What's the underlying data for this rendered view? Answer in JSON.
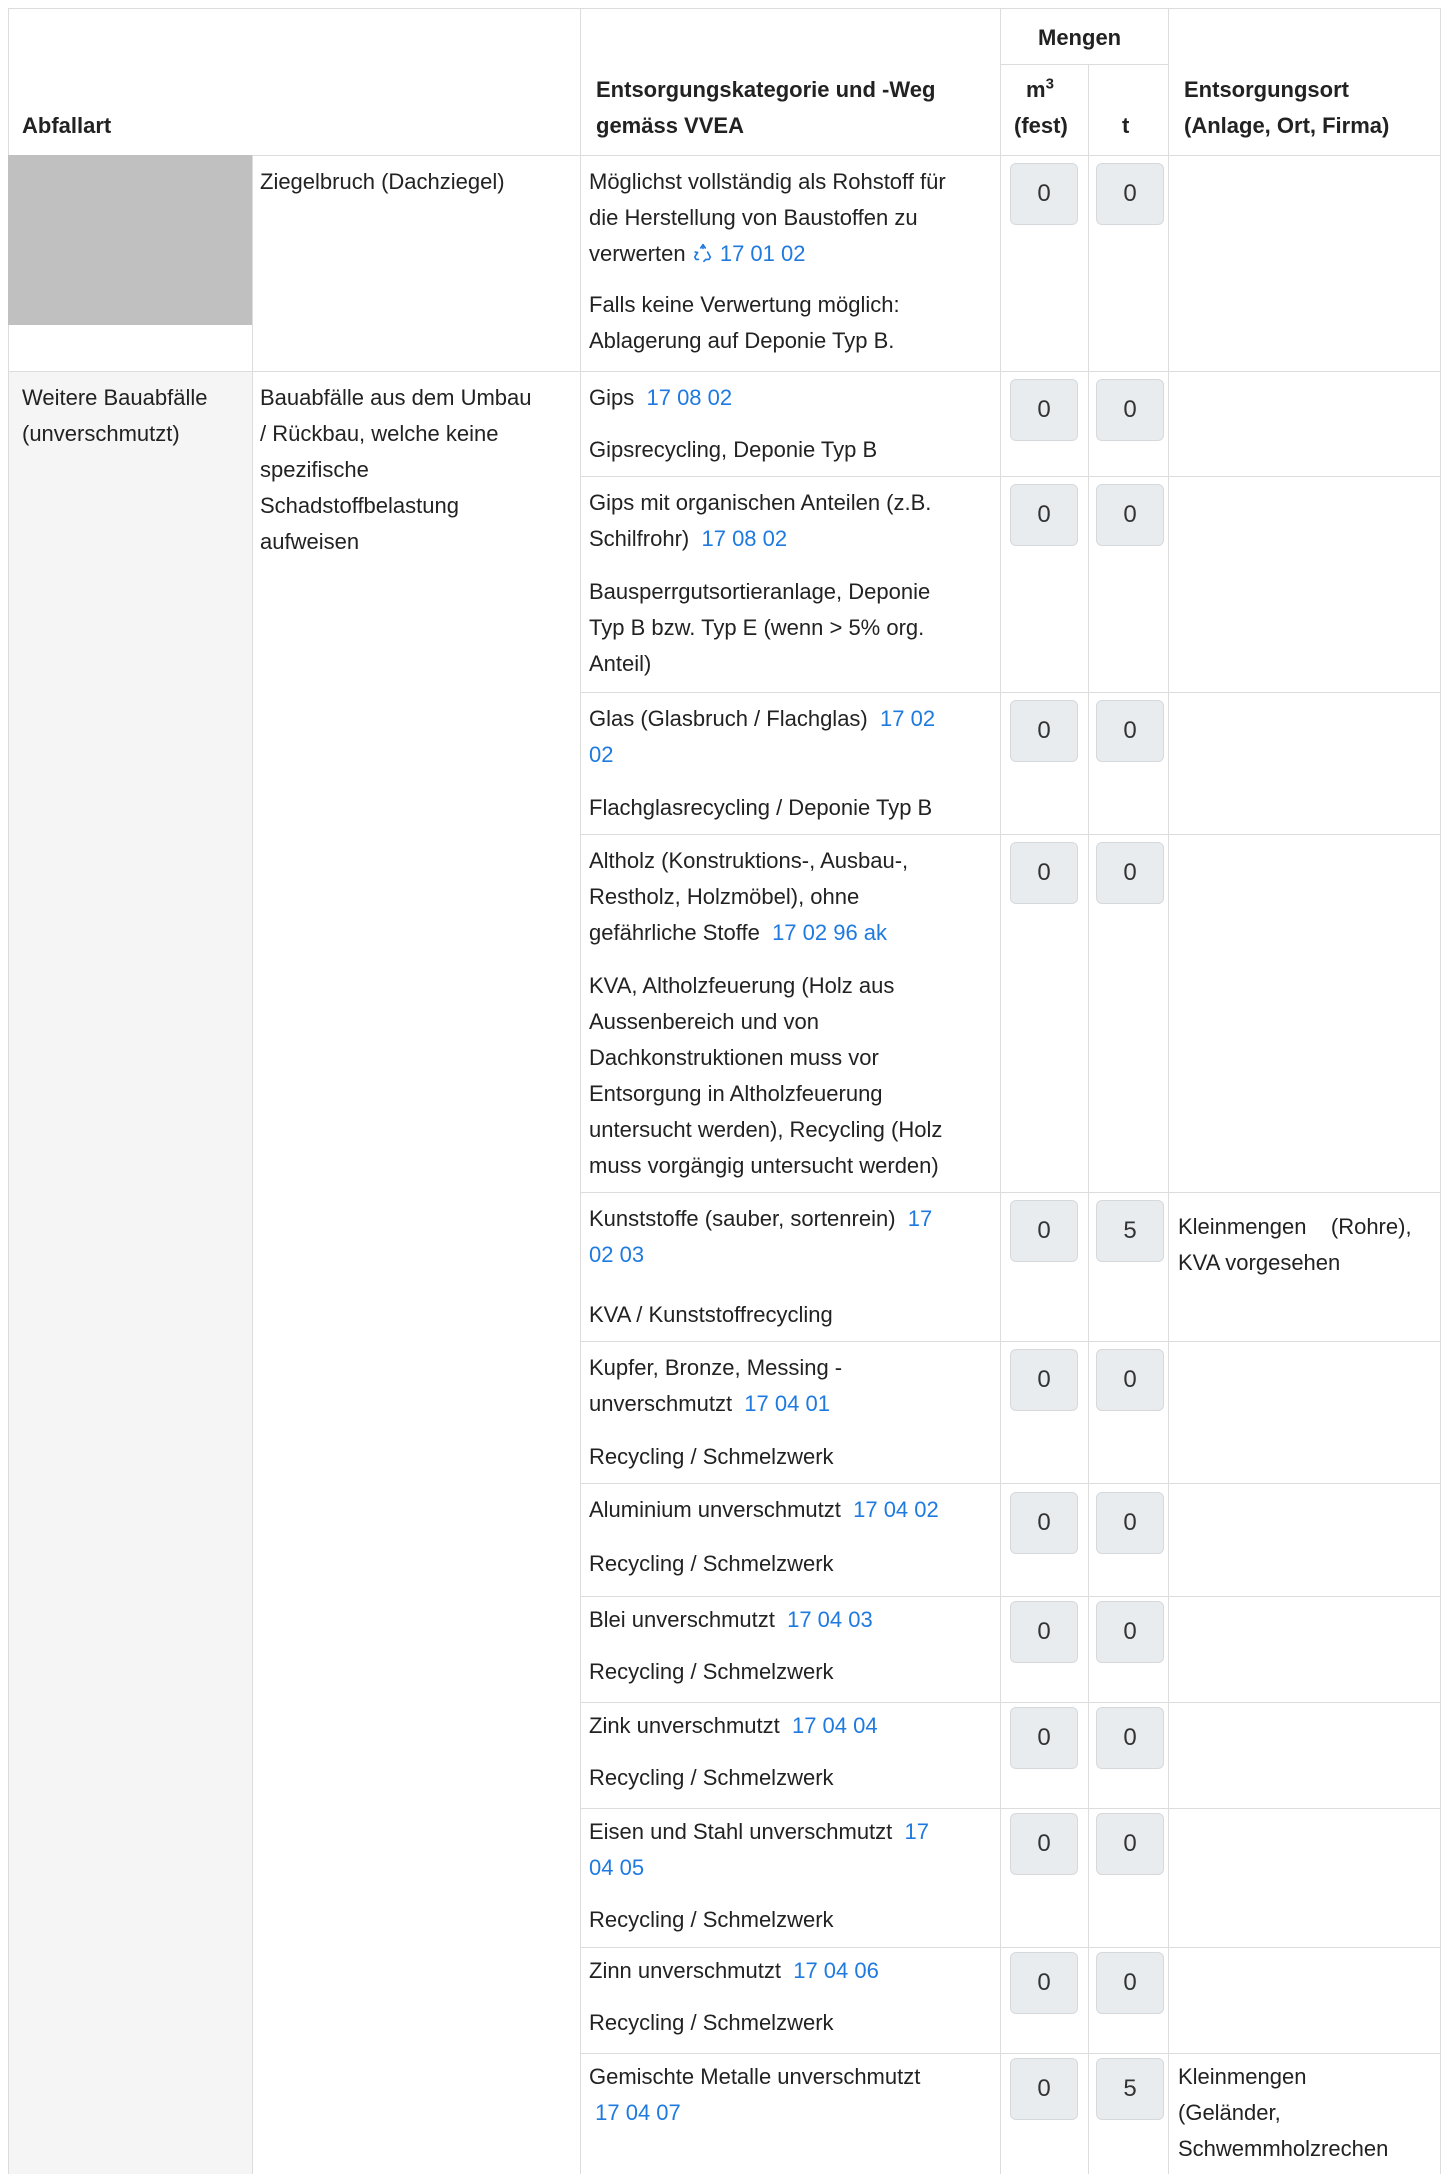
{
  "table": {
    "header": {
      "abfallart": "Abfallart",
      "kategorie_line1": "Entsorgungskategorie und -Weg",
      "kategorie_line2": "gemäss VVEA",
      "mengen": "Mengen",
      "m3_line1": "m",
      "m3_sup": "3",
      "m3_line2": "(fest)",
      "t": "t",
      "ort_line1": "Entsorgungsort",
      "ort_line2": "(Anlage, Ort, Firma)"
    },
    "ziegel": {
      "name": "Ziegelbruch (Dachziegel)",
      "line1": "Möglichst vollständig als Rohstoff für",
      "line2": "die Herstellung von Baustoffen zu",
      "line3": "verwerten",
      "code": "17 01 02",
      "note1": "Falls keine Verwertung möglich:",
      "note2": "Ablagerung auf Deponie Typ B.",
      "m3": "0",
      "t": "0"
    },
    "group": {
      "cat_line1": "Weitere Bauabfälle",
      "cat_line2": "(unverschmutzt)",
      "desc_line1": "Bauabfälle aus dem Umbau",
      "desc_line2": "/ Rückbau, welche keine",
      "desc_line3": "spezifische",
      "desc_line4": "Schadstoffbelastung",
      "desc_line5": "aufweisen"
    },
    "rows": [
      {
        "l1": "Gips",
        "code": "17 08 02",
        "w1": "Gipsrecycling, Deponie Typ B",
        "m3": "0",
        "t": "0"
      },
      {
        "l1": "Gips mit organischen Anteilen (z.B.",
        "l2": "Schilfrohr)",
        "code": "17 08 02",
        "w1": "Bausperrgutsortieranlage, Deponie",
        "w2": "Typ B bzw. Typ E (wenn > 5% org.",
        "w3": "Anteil)",
        "m3": "0",
        "t": "0"
      },
      {
        "l1": "Glas (Glasbruch / Flachglas)",
        "code_a": "17 02",
        "code_b": "02",
        "w1": "Flachglasrecycling / Deponie Typ B",
        "m3": "0",
        "t": "0"
      },
      {
        "l1": "Altholz (Konstruktions-, Ausbau-,",
        "l2": "Restholz, Holzmöbel), ohne",
        "l3": "gefährliche Stoffe",
        "code": "17 02 96 ak",
        "w1": "KVA, Altholzfeuerung (Holz aus",
        "w2": "Aussenbereich und von",
        "w3": "Dachkonstruktionen muss vor",
        "w4": "Entsorgung in Altholzfeuerung",
        "w5": "untersucht werden), Recycling (Holz",
        "w6": "muss vorgängig untersucht werden)",
        "m3": "0",
        "t": "0"
      },
      {
        "l1": "Kunststoffe (sauber, sortenrein)",
        "code_a": "17",
        "code_b": "02 03",
        "w1": "KVA / Kunststoffrecycling",
        "m3": "0",
        "t": "5",
        "ort1": "Kleinmengen    (Rohre),",
        "ort2": "KVA vorgesehen"
      },
      {
        "l1": "Kupfer, Bronze, Messing -",
        "l2": "unverschmutzt",
        "code": "17 04 01",
        "w1": "Recycling / Schmelzwerk",
        "m3": "0",
        "t": "0"
      },
      {
        "l1": "Aluminium unverschmutzt",
        "code": "17 04 02",
        "w1": "Recycling / Schmelzwerk",
        "m3": "0",
        "t": "0"
      },
      {
        "l1": "Blei unverschmutzt",
        "code": "17 04 03",
        "w1": "Recycling / Schmelzwerk",
        "m3": "0",
        "t": "0"
      },
      {
        "l1": "Zink unverschmutzt",
        "code": "17 04 04",
        "w1": "Recycling / Schmelzwerk",
        "m3": "0",
        "t": "0"
      },
      {
        "l1": "Eisen und Stahl unverschmutzt",
        "code_a": "17",
        "code_b": "04 05",
        "w1": "Recycling / Schmelzwerk",
        "m3": "0",
        "t": "0"
      },
      {
        "l1": "Zinn unverschmutzt",
        "code": "17 04 06",
        "w1": "Recycling / Schmelzwerk",
        "m3": "0",
        "t": "0"
      },
      {
        "l1": "Gemischte Metalle unverschmutzt",
        "code": "17 04 07",
        "m3": "0",
        "t": "5",
        "ort1": "Kleinmengen",
        "ort2": "(Geländer,",
        "ort3": "Schwemmholzrechen"
      }
    ]
  },
  "icons": {
    "recycle": "recycle-icon"
  },
  "colors": {
    "link": "#1f7ae0",
    "border": "#dcdcdc",
    "qbox": "#e9ecef",
    "image_placeholder": "#c0c0c0"
  }
}
